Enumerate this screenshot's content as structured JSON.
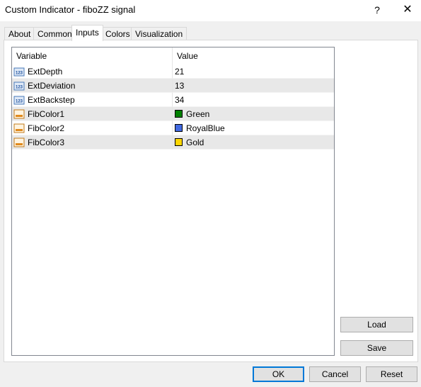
{
  "window": {
    "title": "Custom Indicator - fiboZZ signal",
    "help_glyph": "?",
    "close_glyph": "✕"
  },
  "tabs": [
    {
      "label": "About"
    },
    {
      "label": "Common"
    },
    {
      "label": "Inputs",
      "active": true
    },
    {
      "label": "Colors"
    },
    {
      "label": "Visualization"
    }
  ],
  "grid": {
    "headers": {
      "variable": "Variable",
      "value": "Value"
    },
    "rows": [
      {
        "variable": "ExtDepth",
        "value": "21",
        "icon": "integer-param-icon"
      },
      {
        "variable": "ExtDeviation",
        "value": "13",
        "icon": "integer-param-icon"
      },
      {
        "variable": "ExtBackstep",
        "value": "34",
        "icon": "integer-param-icon"
      },
      {
        "variable": "FibColor1",
        "value": "Green",
        "icon": "color-param-icon",
        "swatch": "#008000"
      },
      {
        "variable": "FibColor2",
        "value": "RoyalBlue",
        "icon": "color-param-icon",
        "swatch": "#4169e1"
      },
      {
        "variable": "FibColor3",
        "value": "Gold",
        "icon": "color-param-icon",
        "swatch": "#ffd700"
      }
    ]
  },
  "side_buttons": {
    "load": "Load",
    "save": "Save"
  },
  "footer_buttons": {
    "ok": "OK",
    "cancel": "Cancel",
    "reset": "Reset"
  },
  "colors": {
    "accent": "#0078d7",
    "row_shade": "#e8e8e8"
  }
}
